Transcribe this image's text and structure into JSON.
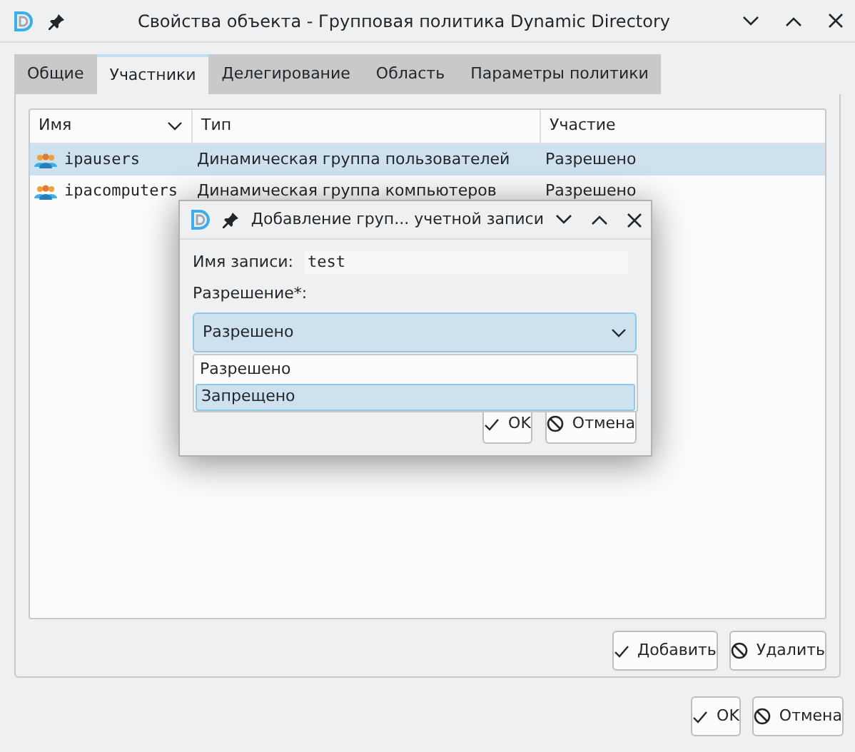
{
  "window": {
    "title": "Свойства объекта - Групповая политика Dynamic Directory"
  },
  "tabs": [
    {
      "label": "Общие",
      "selected": false
    },
    {
      "label": "Участники",
      "selected": true
    },
    {
      "label": "Делегирование",
      "selected": false
    },
    {
      "label": "Область",
      "selected": false
    },
    {
      "label": "Параметры политики",
      "selected": false
    }
  ],
  "table": {
    "columns": [
      "Имя",
      "Тип",
      "Участие"
    ],
    "rows": [
      {
        "name": "ipausers",
        "type": "Динамическая группа пользователей",
        "participation": "Разрешено",
        "selected": true
      },
      {
        "name": "ipacomputers",
        "type": "Динамическая группа компьютеров",
        "participation": "Разрешено",
        "selected": false
      }
    ]
  },
  "panel_buttons": [
    "Добавить",
    "Удалить"
  ],
  "buttons": [
    "OK",
    "Отмена"
  ],
  "dialog": {
    "title": "Добавление груп... учетной записи",
    "name_label": "Имя записи:",
    "name_value": "test",
    "permission_label": "Разрешение*:",
    "combo_value": "Разрешено",
    "options": [
      {
        "label": "Разрешено",
        "selected": false
      },
      {
        "label": "Запрещено",
        "selected": true
      }
    ],
    "buttons": [
      "OK",
      "Отмена"
    ]
  }
}
